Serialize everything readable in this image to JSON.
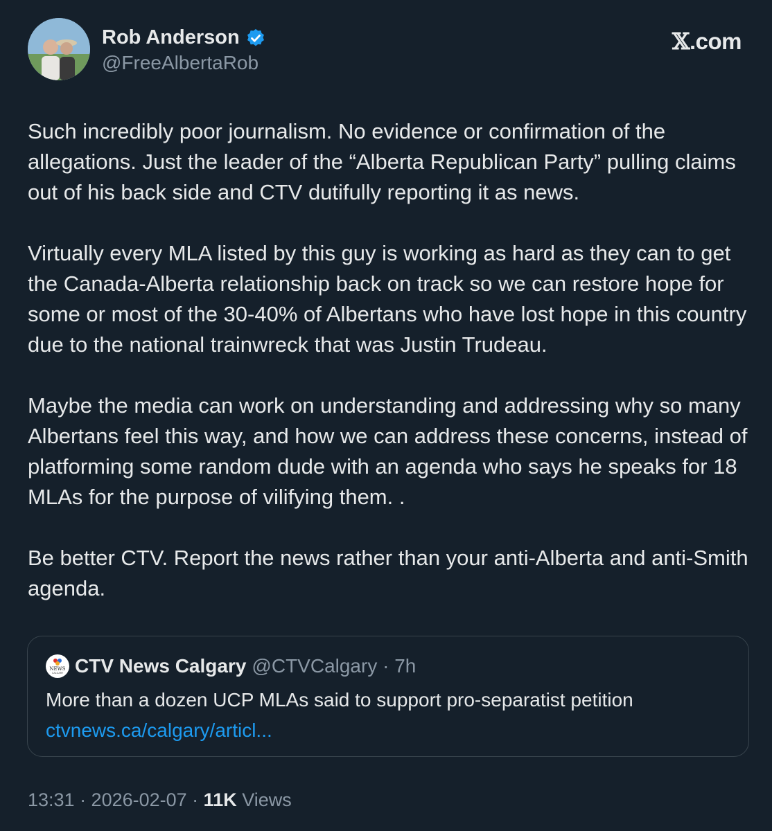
{
  "author": {
    "display_name": "Rob Anderson",
    "handle": "@FreeAlbertaRob",
    "verified_icon": "verified-badge-icon"
  },
  "brand": {
    "x": "𝕏",
    "rest": ".com"
  },
  "tweet": {
    "paragraphs": [
      "Such incredibly poor journalism. No evidence or confirmation of the allegations. Just the leader of the “Alberta Republican Party” pulling claims out of his back side and CTV dutifully reporting it as news.",
      "Virtually every MLA listed by this guy is working as hard as they can to get the Canada-Alberta relationship back on track so we can restore hope for some or most of the 30-40% of Albertans who have lost hope in this country due to the national trainwreck that was Justin Trudeau.",
      "Maybe the media can work on understanding and addressing why so many Albertans feel this way, and how we can address these concerns, instead of platforming some random dude with an agenda who says he speaks for 18 MLAs for the purpose of vilifying them. .",
      "Be better CTV. Report the news rather than your anti-Alberta and anti-Smith agenda."
    ]
  },
  "quoted": {
    "logo_text": "NEWS",
    "logo_sub": "CALGARY",
    "name": "CTV News Calgary",
    "handle_time": "@CTVCalgary · 7h",
    "text": "More than a dozen UCP MLAs said to support pro-separatist petition",
    "link": "ctvnews.ca/calgary/articl..."
  },
  "meta": {
    "time_date": "13:31 · 2026-02-07 · ",
    "views_count": "11K",
    "views_label": " Views"
  },
  "colors": {
    "background": "#15202b",
    "text": "#e7e9ea",
    "secondary": "#8b98a5",
    "link": "#1d9bf0",
    "border": "#38444d"
  }
}
